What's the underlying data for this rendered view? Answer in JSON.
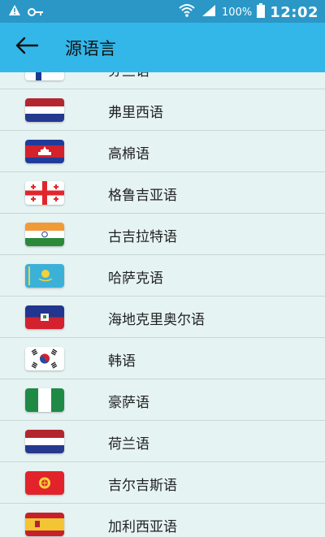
{
  "status_bar": {
    "battery_text": "100%",
    "time": "12:02"
  },
  "app_bar": {
    "title": "源语言"
  },
  "languages": [
    {
      "label": "芬兰语",
      "flag_icon": "finland-flag-icon"
    },
    {
      "label": "弗里西语",
      "flag_icon": "netherlands-flag-icon"
    },
    {
      "label": "高棉语",
      "flag_icon": "cambodia-flag-icon"
    },
    {
      "label": "格鲁吉亚语",
      "flag_icon": "georgia-flag-icon"
    },
    {
      "label": "古吉拉特语",
      "flag_icon": "india-flag-icon"
    },
    {
      "label": "哈萨克语",
      "flag_icon": "kazakhstan-flag-icon"
    },
    {
      "label": "海地克里奥尔语",
      "flag_icon": "haiti-flag-icon"
    },
    {
      "label": "韩语",
      "flag_icon": "south-korea-flag-icon"
    },
    {
      "label": "豪萨语",
      "flag_icon": "nigeria-flag-icon"
    },
    {
      "label": "荷兰语",
      "flag_icon": "netherlands-flag-icon"
    },
    {
      "label": "吉尔吉斯语",
      "flag_icon": "kyrgyzstan-flag-icon"
    },
    {
      "label": "加利西亚语",
      "flag_icon": "spain-flag-icon"
    }
  ],
  "colors": {
    "status_bar": "#2a97c7",
    "app_bar": "#33b7e8",
    "list_bg": "#e6f3f3"
  }
}
